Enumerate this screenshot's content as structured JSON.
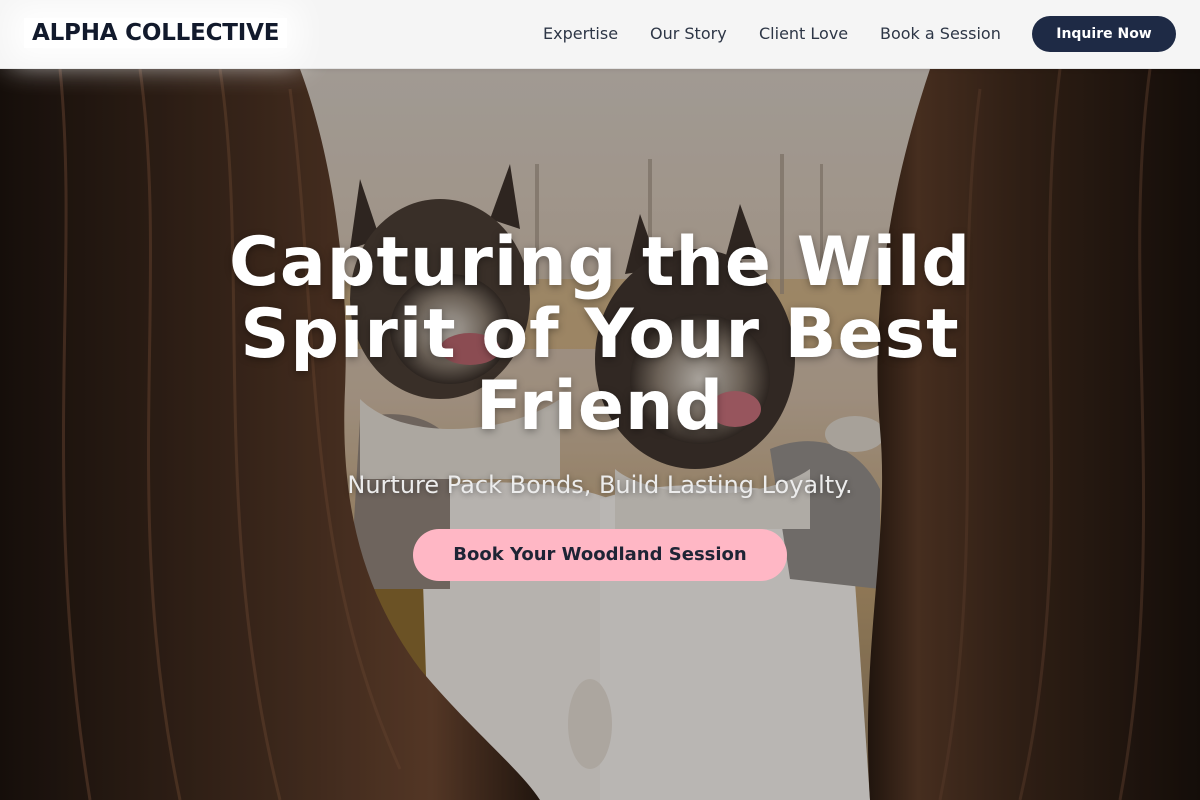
{
  "brand": {
    "name": "ALPHA COLLECTIVE"
  },
  "nav": {
    "items": [
      {
        "label": "Expertise"
      },
      {
        "label": "Our Story"
      },
      {
        "label": "Client Love"
      },
      {
        "label": "Book a Session"
      }
    ],
    "cta_label": "Inquire Now"
  },
  "hero": {
    "title": "Capturing the Wild Spirit of Your Best Friend",
    "subtitle": "Nurture Pack Bonds, Build Lasting Loyalty.",
    "cta_label": "Book Your Woodland Session"
  },
  "colors": {
    "primary_navy": "#1e2a45",
    "accent_pink": "#ffb7c5",
    "header_bg": "#f5f5f5"
  }
}
